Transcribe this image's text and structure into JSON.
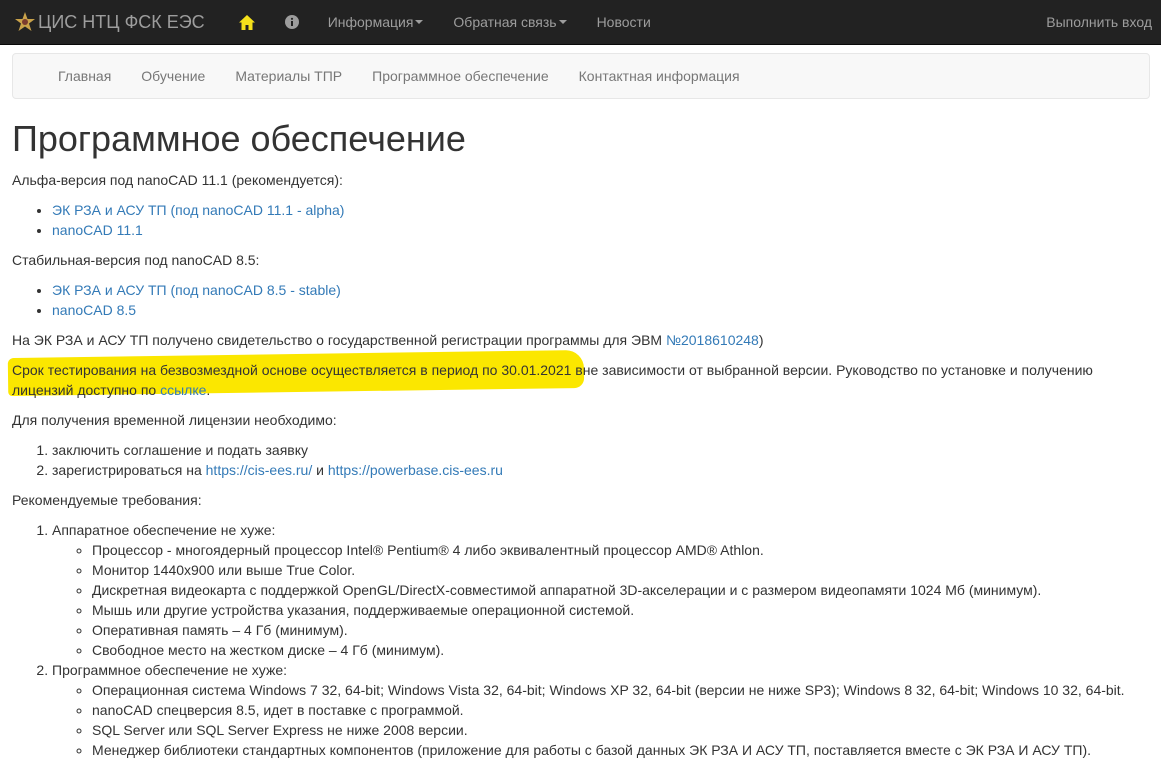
{
  "topbar": {
    "brand": "ЦИС НТЦ ФСК ЕЭС",
    "menu_info": "Информация",
    "menu_feedback": "Обратная связь",
    "menu_news": "Новости",
    "login": "Выполнить вход"
  },
  "subnav": {
    "items": [
      "Главная",
      "Обучение",
      "Материалы ТПР",
      "Программное обеспечение",
      "Контактная информация"
    ]
  },
  "page": {
    "title": "Программное обеспечение",
    "alpha_heading": "Альфа-версия под nanoCAD 11.1 (рекомендуется):",
    "alpha_links": [
      "ЭК РЗА и АСУ ТП (под nanoCAD 11.1 - alpha)",
      "nanoCAD 11.1"
    ],
    "stable_heading": "Стабильная-версия под nanoCAD 8.5:",
    "stable_links": [
      "ЭК РЗА и АСУ ТП (под nanoCAD 8.5 - stable)",
      "nanoCAD 8.5"
    ],
    "certificate_text": "На ЭК РЗА и АСУ ТП получено свидетельство о государственной регистрации программы для ЭВМ ",
    "certificate_link": "№2018610248",
    "certificate_close": ")",
    "testing_highlight": "Срок тестирования на безвозмездной основе осуществляется в период по 30.01.2021",
    "testing_rest": " вне зависимости от выбранной версии. Руководство по установке и получению лицензий доступно по ",
    "testing_link": "ссылке",
    "testing_end": ".",
    "license_heading": "Для получения временной лицензии необходимо:",
    "license_step1": "заключить соглашение и подать заявку",
    "license_step2_text": "зарегистрироваться на ",
    "license_link1": "https://cis-ees.ru/",
    "license_and": " и ",
    "license_link2": "https://powerbase.cis-ees.ru",
    "req_heading": "Рекомендуемые требования:",
    "hw_heading": "Аппаратное обеспечение не хуже:",
    "hw_items": [
      "Процессор - многоядерный процессор Intel® Pentium® 4 либо эквивалентный процессор AMD® Athlon.",
      "Монитор 1440х900 или выше True Color.",
      "Дискретная видеокарта с поддержкой OpenGL/DirectX-совместимой аппаратной 3D-акселерации и с размером видеопамяти 1024 Мб (минимум).",
      "Мышь или другие устройства указания, поддерживаемые операционной системой.",
      "Оперативная память – 4 Гб (минимум).",
      "Свободное место на жестком диске – 4 Гб (минимум)."
    ],
    "sw_heading": "Программное обеспечение не хуже:",
    "sw_items": [
      "Операционная система Windows 7 32, 64-bit; Windows Vista 32, 64-bit; Windows XP 32, 64-bit (версии не ниже SP3); Windows 8 32, 64-bit; Windows 10 32, 64-bit.",
      "nanoCAD спецверсия 8.5, идет в поставке с программой.",
      "SQL Server или SQL Server Express не ниже 2008 версии.",
      "Менеджер библиотеки стандартных компонентов (приложение для работы с базой данных ЭК РЗА И АСУ ТП, поставляется вместе с ЭК РЗА И АСУ ТП)."
    ]
  },
  "colors": {
    "navbar": "#222222",
    "link": "#337ab7",
    "home_icon": "#f5e11b",
    "highlight": "#fbe700"
  }
}
